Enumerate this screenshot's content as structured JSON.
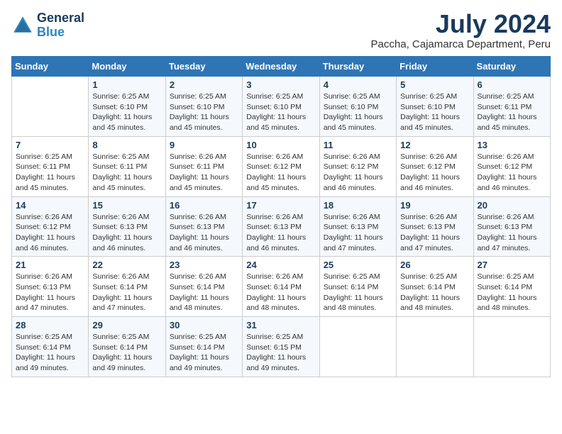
{
  "header": {
    "logo_text_general": "General",
    "logo_text_blue": "Blue",
    "month_year": "July 2024",
    "location": "Paccha, Cajamarca Department, Peru"
  },
  "calendar": {
    "days_of_week": [
      "Sunday",
      "Monday",
      "Tuesday",
      "Wednesday",
      "Thursday",
      "Friday",
      "Saturday"
    ],
    "weeks": [
      [
        {
          "day": "",
          "info": ""
        },
        {
          "day": "1",
          "info": "Sunrise: 6:25 AM\nSunset: 6:10 PM\nDaylight: 11 hours\nand 45 minutes."
        },
        {
          "day": "2",
          "info": "Sunrise: 6:25 AM\nSunset: 6:10 PM\nDaylight: 11 hours\nand 45 minutes."
        },
        {
          "day": "3",
          "info": "Sunrise: 6:25 AM\nSunset: 6:10 PM\nDaylight: 11 hours\nand 45 minutes."
        },
        {
          "day": "4",
          "info": "Sunrise: 6:25 AM\nSunset: 6:10 PM\nDaylight: 11 hours\nand 45 minutes."
        },
        {
          "day": "5",
          "info": "Sunrise: 6:25 AM\nSunset: 6:10 PM\nDaylight: 11 hours\nand 45 minutes."
        },
        {
          "day": "6",
          "info": "Sunrise: 6:25 AM\nSunset: 6:11 PM\nDaylight: 11 hours\nand 45 minutes."
        }
      ],
      [
        {
          "day": "7",
          "info": "Sunrise: 6:25 AM\nSunset: 6:11 PM\nDaylight: 11 hours\nand 45 minutes."
        },
        {
          "day": "8",
          "info": "Sunrise: 6:25 AM\nSunset: 6:11 PM\nDaylight: 11 hours\nand 45 minutes."
        },
        {
          "day": "9",
          "info": "Sunrise: 6:26 AM\nSunset: 6:11 PM\nDaylight: 11 hours\nand 45 minutes."
        },
        {
          "day": "10",
          "info": "Sunrise: 6:26 AM\nSunset: 6:12 PM\nDaylight: 11 hours\nand 45 minutes."
        },
        {
          "day": "11",
          "info": "Sunrise: 6:26 AM\nSunset: 6:12 PM\nDaylight: 11 hours\nand 46 minutes."
        },
        {
          "day": "12",
          "info": "Sunrise: 6:26 AM\nSunset: 6:12 PM\nDaylight: 11 hours\nand 46 minutes."
        },
        {
          "day": "13",
          "info": "Sunrise: 6:26 AM\nSunset: 6:12 PM\nDaylight: 11 hours\nand 46 minutes."
        }
      ],
      [
        {
          "day": "14",
          "info": "Sunrise: 6:26 AM\nSunset: 6:12 PM\nDaylight: 11 hours\nand 46 minutes."
        },
        {
          "day": "15",
          "info": "Sunrise: 6:26 AM\nSunset: 6:13 PM\nDaylight: 11 hours\nand 46 minutes."
        },
        {
          "day": "16",
          "info": "Sunrise: 6:26 AM\nSunset: 6:13 PM\nDaylight: 11 hours\nand 46 minutes."
        },
        {
          "day": "17",
          "info": "Sunrise: 6:26 AM\nSunset: 6:13 PM\nDaylight: 11 hours\nand 46 minutes."
        },
        {
          "day": "18",
          "info": "Sunrise: 6:26 AM\nSunset: 6:13 PM\nDaylight: 11 hours\nand 47 minutes."
        },
        {
          "day": "19",
          "info": "Sunrise: 6:26 AM\nSunset: 6:13 PM\nDaylight: 11 hours\nand 47 minutes."
        },
        {
          "day": "20",
          "info": "Sunrise: 6:26 AM\nSunset: 6:13 PM\nDaylight: 11 hours\nand 47 minutes."
        }
      ],
      [
        {
          "day": "21",
          "info": "Sunrise: 6:26 AM\nSunset: 6:13 PM\nDaylight: 11 hours\nand 47 minutes."
        },
        {
          "day": "22",
          "info": "Sunrise: 6:26 AM\nSunset: 6:14 PM\nDaylight: 11 hours\nand 47 minutes."
        },
        {
          "day": "23",
          "info": "Sunrise: 6:26 AM\nSunset: 6:14 PM\nDaylight: 11 hours\nand 48 minutes."
        },
        {
          "day": "24",
          "info": "Sunrise: 6:26 AM\nSunset: 6:14 PM\nDaylight: 11 hours\nand 48 minutes."
        },
        {
          "day": "25",
          "info": "Sunrise: 6:25 AM\nSunset: 6:14 PM\nDaylight: 11 hours\nand 48 minutes."
        },
        {
          "day": "26",
          "info": "Sunrise: 6:25 AM\nSunset: 6:14 PM\nDaylight: 11 hours\nand 48 minutes."
        },
        {
          "day": "27",
          "info": "Sunrise: 6:25 AM\nSunset: 6:14 PM\nDaylight: 11 hours\nand 48 minutes."
        }
      ],
      [
        {
          "day": "28",
          "info": "Sunrise: 6:25 AM\nSunset: 6:14 PM\nDaylight: 11 hours\nand 49 minutes."
        },
        {
          "day": "29",
          "info": "Sunrise: 6:25 AM\nSunset: 6:14 PM\nDaylight: 11 hours\nand 49 minutes."
        },
        {
          "day": "30",
          "info": "Sunrise: 6:25 AM\nSunset: 6:14 PM\nDaylight: 11 hours\nand 49 minutes."
        },
        {
          "day": "31",
          "info": "Sunrise: 6:25 AM\nSunset: 6:15 PM\nDaylight: 11 hours\nand 49 minutes."
        },
        {
          "day": "",
          "info": ""
        },
        {
          "day": "",
          "info": ""
        },
        {
          "day": "",
          "info": ""
        }
      ]
    ]
  }
}
